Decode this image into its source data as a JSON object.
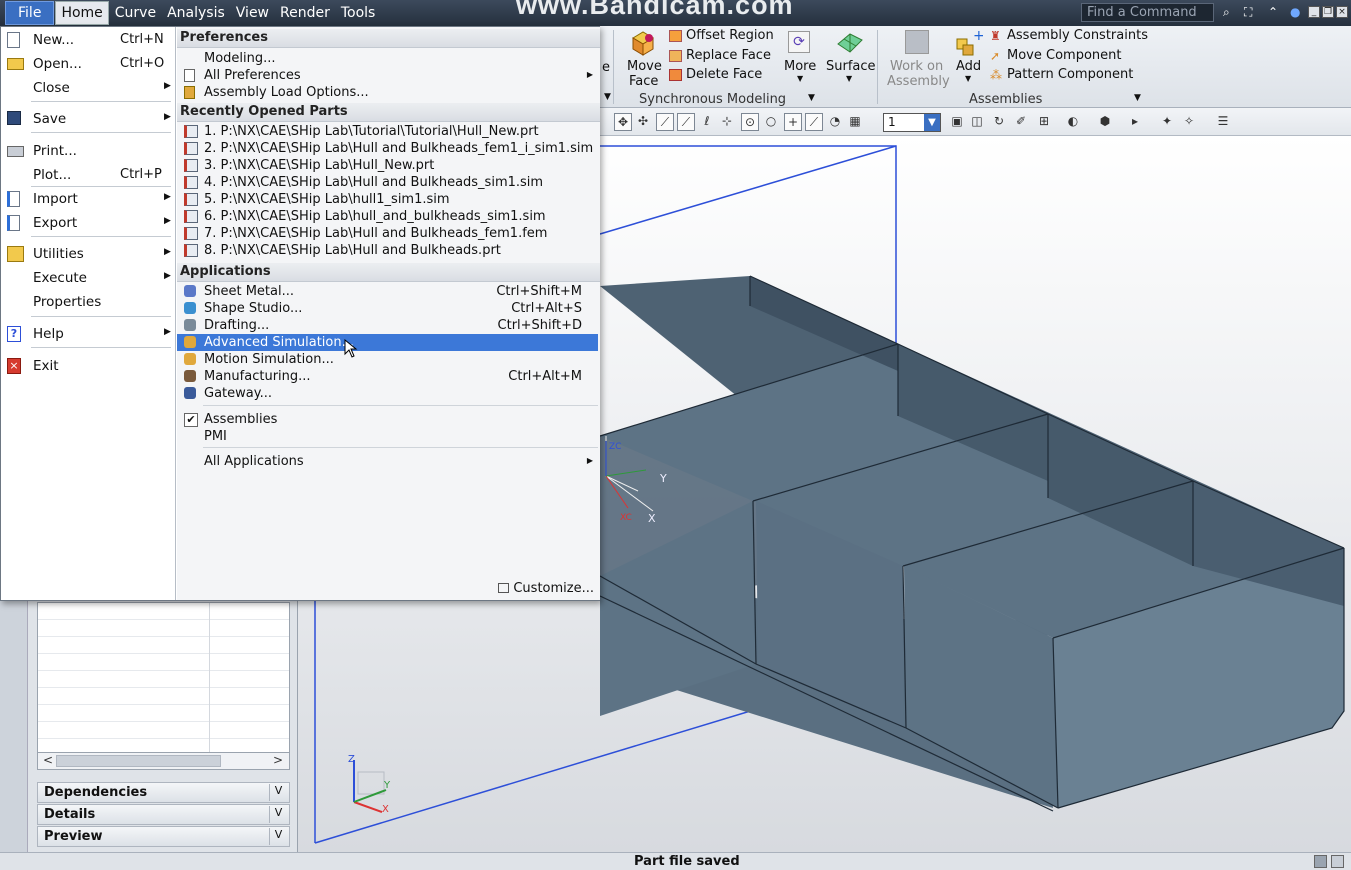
{
  "menubar": {
    "items": [
      "File",
      "Home",
      "Curve",
      "Analysis",
      "View",
      "Render",
      "Tools"
    ],
    "watermark": "www.Bandicam.com",
    "find_placeholder": "Find a Command"
  },
  "ribbon": {
    "partial_label": "e",
    "move_face": [
      "Move",
      "Face"
    ],
    "offset_region": "Offset Region",
    "replace_face": "Replace Face",
    "delete_face": "Delete Face",
    "more": "More",
    "surface": "Surface",
    "work_on_assembly": [
      "Work on",
      "Assembly"
    ],
    "add": "Add",
    "assembly_constraints": "Assembly Constraints",
    "move_component": "Move Component",
    "pattern_component": "Pattern Component",
    "group_synchronous": "Synchronous Modeling",
    "group_assemblies": "Assemblies"
  },
  "toolbar": {
    "layer_value": "1"
  },
  "file_menu": {
    "left_items": [
      {
        "label": "New...",
        "shortcut": "Ctrl+N",
        "icon": "new-file-icon"
      },
      {
        "label": "Open...",
        "shortcut": "Ctrl+O",
        "icon": "open-folder-icon"
      },
      {
        "label": "Close",
        "shortcut": "",
        "icon": "",
        "submenu": true
      },
      {
        "label": "Save",
        "shortcut": "",
        "icon": "save-disk-icon",
        "submenu": true
      },
      {
        "label": "Print...",
        "shortcut": "",
        "icon": "printer-icon"
      },
      {
        "label": "Plot...",
        "shortcut": "Ctrl+P",
        "icon": ""
      },
      {
        "label": "Import",
        "shortcut": "",
        "icon": "import-icon",
        "submenu": true
      },
      {
        "label": "Export",
        "shortcut": "",
        "icon": "export-icon",
        "submenu": true
      },
      {
        "label": "Utilities",
        "shortcut": "",
        "icon": "utilities-icon",
        "submenu": true
      },
      {
        "label": "Execute",
        "shortcut": "",
        "icon": "",
        "submenu": true
      },
      {
        "label": "Properties",
        "shortcut": "",
        "icon": ""
      },
      {
        "label": "Help",
        "shortcut": "",
        "icon": "help-icon",
        "submenu": true
      },
      {
        "label": "Exit",
        "shortcut": "",
        "icon": "exit-icon"
      }
    ],
    "sections": {
      "preferences": "Preferences",
      "recent": "Recently Opened Parts",
      "applications": "Applications"
    },
    "preferences": [
      {
        "label": "Modeling...",
        "submenu": false
      },
      {
        "label": "All Preferences",
        "submenu": true
      },
      {
        "label": "Assembly Load Options...",
        "submenu": false
      }
    ],
    "recent": [
      "1. P:\\NX\\CAE\\SHip Lab\\Tutorial\\Tutorial\\Hull_New.prt",
      "2. P:\\NX\\CAE\\SHip Lab\\Hull and Bulkheads_fem1_i_sim1.sim",
      "3. P:\\NX\\CAE\\SHip Lab\\Hull_New.prt",
      "4. P:\\NX\\CAE\\SHip Lab\\Hull and Bulkheads_sim1.sim",
      "5. P:\\NX\\CAE\\SHip Lab\\hull1_sim1.sim",
      "6. P:\\NX\\CAE\\SHip Lab\\hull_and_bulkheads_sim1.sim",
      "7. P:\\NX\\CAE\\SHip Lab\\Hull and Bulkheads_fem1.fem",
      "8. P:\\NX\\CAE\\SHip Lab\\Hull and Bulkheads.prt"
    ],
    "applications": [
      {
        "label": "Sheet Metal...",
        "shortcut": "Ctrl+Shift+M"
      },
      {
        "label": "Shape Studio...",
        "shortcut": "Ctrl+Alt+S"
      },
      {
        "label": "Drafting...",
        "shortcut": "Ctrl+Shift+D"
      },
      {
        "label": "Advanced Simulation...",
        "shortcut": "",
        "highlighted": true
      },
      {
        "label": "Motion Simulation...",
        "shortcut": ""
      },
      {
        "label": "Manufacturing...",
        "shortcut": "Ctrl+Alt+M"
      },
      {
        "label": "Gateway...",
        "shortcut": ""
      }
    ],
    "toggles": [
      {
        "label": "Assemblies",
        "checked": true
      },
      {
        "label": "PMI",
        "checked": false
      }
    ],
    "all_applications": "All Applications",
    "customize": "Customize..."
  },
  "navigator": {
    "panels": [
      "Dependencies",
      "Details",
      "Preview"
    ]
  },
  "axes": {
    "y": "Y",
    "x": "X",
    "zc": "ZC",
    "xc": "XC",
    "z": "Z"
  },
  "status": {
    "text": "Part file saved"
  }
}
